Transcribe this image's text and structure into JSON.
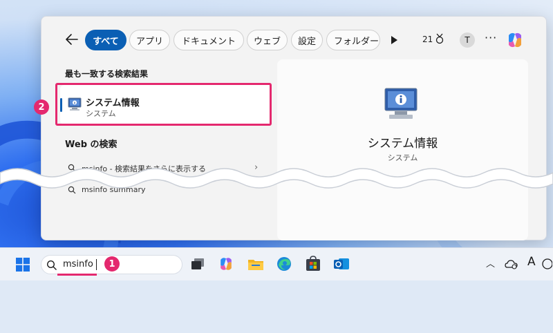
{
  "filters": {
    "back_icon": "arrow-left-icon",
    "chips": [
      {
        "label": "すべて",
        "active": true
      },
      {
        "label": "アプリ",
        "active": false
      },
      {
        "label": "ドキュメント",
        "active": false
      },
      {
        "label": "ウェブ",
        "active": false
      },
      {
        "label": "設定",
        "active": false
      },
      {
        "label": "フォルダー",
        "active": false
      }
    ],
    "points": "21",
    "avatar": "T",
    "more": "···"
  },
  "best_match": {
    "heading": "最も一致する検索結果",
    "title": "システム情報",
    "subtitle": "システム"
  },
  "web_search": {
    "heading": "Web の検索",
    "rows": [
      {
        "text": "msinfo - 検索結果をさらに表示する"
      },
      {
        "text": "msinfo summary"
      }
    ]
  },
  "preview": {
    "title": "システム情報",
    "subtitle": "システム"
  },
  "taskbar": {
    "search_value": "msinfo",
    "tray_letter": "A"
  },
  "annotations": {
    "step1": "1",
    "step2": "2",
    "color": "#e4286e"
  },
  "colors": {
    "accent": "#0a5fb4"
  }
}
